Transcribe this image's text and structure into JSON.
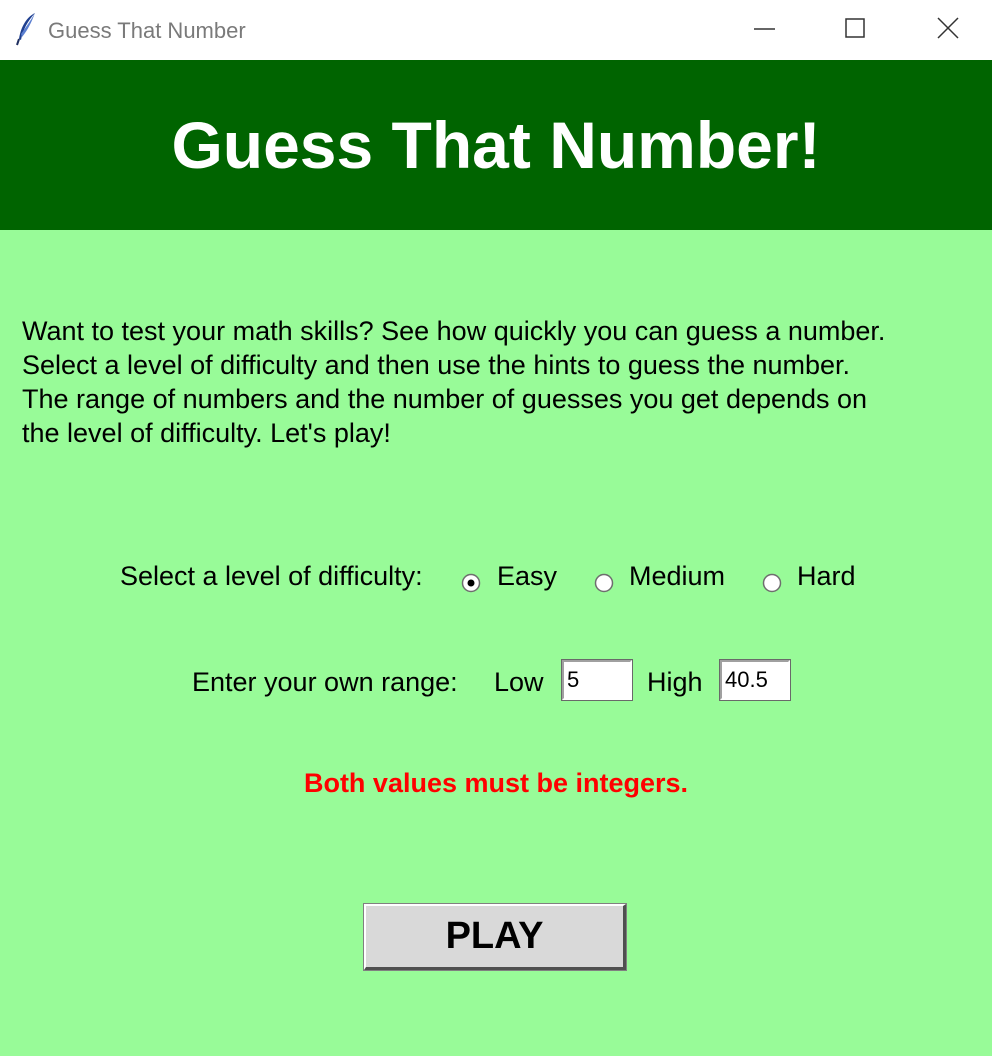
{
  "window": {
    "title": "Guess That Number",
    "icon": "feather-icon",
    "controls": [
      "minimize-icon",
      "maximize-icon",
      "close-icon"
    ]
  },
  "header": {
    "title": "Guess That Number!",
    "background": "#006400",
    "color": "#ffffff"
  },
  "intro": {
    "lines": [
      "Want to test your math skills?  See how quickly you can guess a number.",
      "Select a level of difficulty and then use the hints to guess the number.",
      "The range of numbers and the number of guesses you get depends on",
      "the level of difficulty.  Let's play!"
    ]
  },
  "difficulty": {
    "label": "Select a level of difficulty:",
    "options": [
      {
        "label": "Easy",
        "selected": true
      },
      {
        "label": "Medium",
        "selected": false
      },
      {
        "label": "Hard",
        "selected": false
      }
    ]
  },
  "range": {
    "label": "Enter your own range:",
    "low_label": "Low",
    "low_value": "5",
    "high_label": "High",
    "high_value": "40.5"
  },
  "error": {
    "message": "Both values must be integers.",
    "color": "#ff0000"
  },
  "play_button": {
    "label": "PLAY"
  },
  "colors": {
    "background": "#98fb98",
    "header": "#006400",
    "button": "#d9d9d9"
  }
}
